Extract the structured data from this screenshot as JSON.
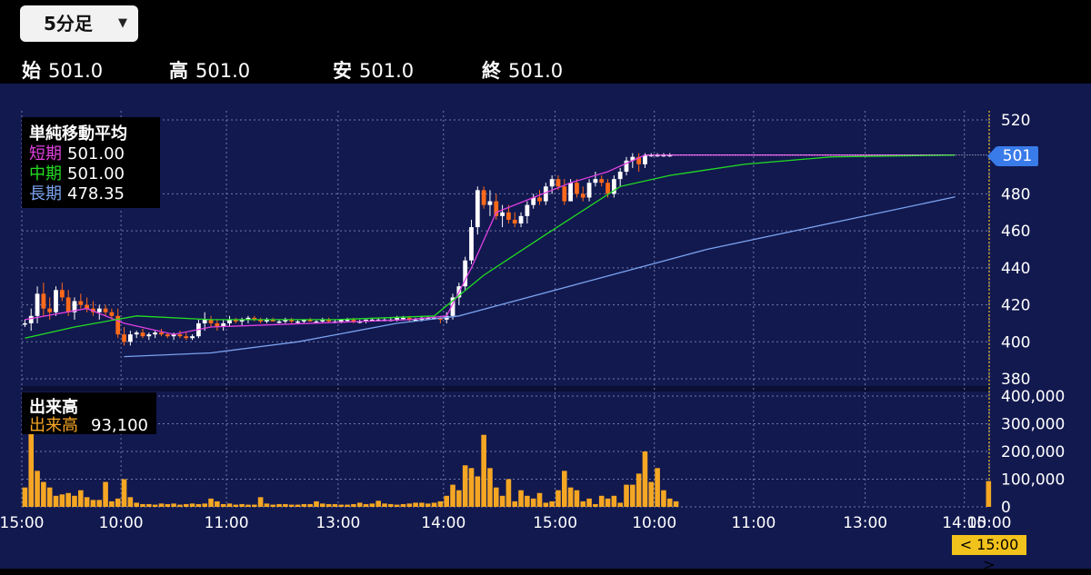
{
  "timeframe": {
    "selected": "5分足",
    "icon": "chevron-down-icon"
  },
  "ohlc": [
    {
      "label": "始",
      "value": "501.0"
    },
    {
      "label": "高",
      "value": "501.0"
    },
    {
      "label": "安",
      "value": "501.0"
    },
    {
      "label": "終",
      "value": "501.0"
    }
  ],
  "legend": {
    "title": "単純移動平均",
    "items": [
      {
        "label": "短期",
        "value": "501.00",
        "color": "#e040e0"
      },
      {
        "label": "中期",
        "value": "501.00",
        "color": "#22dd22"
      },
      {
        "label": "長期",
        "value": "478.35",
        "color": "#7aa2ee"
      }
    ]
  },
  "volume_legend": {
    "title": "出来高",
    "label": "出来高",
    "value": "93,100",
    "color": "#f5a623"
  },
  "current_price": "501",
  "current_time": "< 15:00 >",
  "colors": {
    "background": "#12194f",
    "up": "#ffffff",
    "down": "#ff6a1a",
    "volume": "#f5a623",
    "grid": "#6f7aa8",
    "current": "#3a7bea",
    "time_badge": "#f2c21c"
  },
  "chart_data": [
    {
      "type": "candlestick",
      "y_ticks": [
        520,
        480,
        460,
        440,
        420,
        400,
        380
      ],
      "ylim": [
        380,
        520
      ],
      "x_tick_labels": [
        "15:00",
        "10:00",
        "11:00",
        "13:00",
        "14:00",
        "15:00",
        "10:00",
        "11:00",
        "13:00",
        "14:00",
        "15:00"
      ],
      "candles": [
        [
          410,
          412,
          408,
          410
        ],
        [
          410,
          418,
          406,
          414
        ],
        [
          414,
          430,
          410,
          426
        ],
        [
          426,
          432,
          414,
          418
        ],
        [
          418,
          424,
          412,
          416
        ],
        [
          416,
          430,
          414,
          428
        ],
        [
          428,
          432,
          422,
          424
        ],
        [
          424,
          428,
          414,
          416
        ],
        [
          416,
          424,
          412,
          422
        ],
        [
          422,
          426,
          418,
          420
        ],
        [
          420,
          424,
          416,
          418
        ],
        [
          418,
          422,
          414,
          416
        ],
        [
          416,
          420,
          412,
          418
        ],
        [
          418,
          420,
          414,
          416
        ],
        [
          416,
          418,
          412,
          414
        ],
        [
          414,
          418,
          402,
          404
        ],
        [
          404,
          408,
          398,
          400
        ],
        [
          400,
          406,
          398,
          404
        ],
        [
          404,
          406,
          402,
          405
        ],
        [
          405,
          407,
          402,
          403
        ],
        [
          403,
          405,
          401,
          404
        ],
        [
          404,
          406,
          402,
          405
        ],
        [
          405,
          407,
          403,
          404
        ],
        [
          404,
          405,
          402,
          403
        ],
        [
          403,
          405,
          401,
          404
        ],
        [
          404,
          406,
          402,
          403
        ],
        [
          403,
          405,
          401,
          402
        ],
        [
          402,
          404,
          401,
          403
        ],
        [
          403,
          412,
          402,
          410
        ],
        [
          410,
          416,
          406,
          412
        ],
        [
          412,
          414,
          408,
          410
        ],
        [
          410,
          412,
          406,
          408
        ],
        [
          408,
          412,
          406,
          410
        ],
        [
          410,
          414,
          408,
          412
        ],
        [
          412,
          413,
          410,
          411
        ],
        [
          411,
          413,
          409,
          412
        ],
        [
          412,
          414,
          410,
          413
        ],
        [
          413,
          414,
          411,
          412
        ],
        [
          412,
          413,
          410,
          411
        ],
        [
          411,
          413,
          410,
          412
        ],
        [
          412,
          413,
          411,
          411
        ],
        [
          411,
          412,
          410,
          411
        ],
        [
          411,
          413,
          410,
          412
        ],
        [
          412,
          413,
          410,
          411
        ],
        [
          411,
          412,
          410,
          411
        ],
        [
          411,
          412,
          410,
          412
        ],
        [
          412,
          413,
          411,
          411
        ],
        [
          411,
          412,
          410,
          411
        ],
        [
          411,
          413,
          410,
          412
        ],
        [
          412,
          413,
          410,
          411
        ],
        [
          411,
          412,
          410,
          411
        ],
        [
          411,
          412,
          410,
          412
        ],
        [
          412,
          413,
          411,
          412
        ],
        [
          412,
          413,
          410,
          411
        ],
        [
          411,
          412,
          410,
          411
        ],
        [
          411,
          412,
          410,
          412
        ],
        [
          412,
          413,
          411,
          412
        ],
        [
          412,
          413,
          411,
          412
        ],
        [
          412,
          413,
          411,
          412
        ],
        [
          412,
          413,
          411,
          412
        ],
        [
          412,
          414,
          411,
          413
        ],
        [
          413,
          414,
          412,
          413
        ],
        [
          413,
          414,
          411,
          412
        ],
        [
          412,
          413,
          411,
          412
        ],
        [
          412,
          414,
          411,
          413
        ],
        [
          413,
          414,
          412,
          413
        ],
        [
          413,
          414,
          412,
          413
        ],
        [
          413,
          414,
          410,
          412
        ],
        [
          412,
          416,
          410,
          414
        ],
        [
          414,
          426,
          412,
          424
        ],
        [
          424,
          432,
          420,
          430
        ],
        [
          430,
          446,
          428,
          444
        ],
        [
          444,
          466,
          442,
          462
        ],
        [
          462,
          484,
          458,
          482
        ],
        [
          482,
          484,
          472,
          474
        ],
        [
          474,
          482,
          468,
          476
        ],
        [
          476,
          480,
          466,
          468
        ],
        [
          468,
          474,
          462,
          470
        ],
        [
          470,
          474,
          464,
          466
        ],
        [
          466,
          470,
          462,
          464
        ],
        [
          464,
          470,
          462,
          468
        ],
        [
          468,
          476,
          464,
          474
        ],
        [
          474,
          480,
          472,
          478
        ],
        [
          478,
          482,
          474,
          476
        ],
        [
          476,
          486,
          474,
          484
        ],
        [
          484,
          490,
          480,
          488
        ],
        [
          488,
          490,
          482,
          484
        ],
        [
          484,
          488,
          474,
          476
        ],
        [
          476,
          488,
          476,
          486
        ],
        [
          486,
          488,
          478,
          480
        ],
        [
          480,
          484,
          476,
          478
        ],
        [
          478,
          488,
          476,
          486
        ],
        [
          486,
          492,
          484,
          488
        ],
        [
          488,
          490,
          484,
          486
        ],
        [
          486,
          488,
          478,
          480
        ],
        [
          480,
          490,
          478,
          488
        ],
        [
          488,
          494,
          484,
          492
        ],
        [
          492,
          500,
          490,
          498
        ],
        [
          498,
          502,
          494,
          500
        ],
        [
          500,
          502,
          492,
          496
        ],
        [
          496,
          502,
          494,
          501
        ],
        [
          501,
          502,
          500,
          501
        ],
        [
          501,
          502,
          500,
          501
        ],
        [
          501,
          502,
          500,
          501
        ],
        [
          501,
          502,
          500,
          501
        ]
      ],
      "sma": [
        {
          "name": "短期",
          "x": [
            0,
            10,
            16,
            24,
            30,
            62,
            68,
            72,
            76,
            82,
            88,
            94,
            100,
            150
          ],
          "values": [
            412,
            418,
            410,
            404,
            408,
            412,
            414,
            440,
            470,
            478,
            486,
            492,
            501,
            501
          ]
        },
        {
          "name": "中期",
          "x": [
            0,
            8,
            18,
            30,
            50,
            66,
            74,
            84,
            96,
            104,
            116,
            130,
            150
          ],
          "values": [
            402,
            408,
            414,
            412,
            412,
            414,
            436,
            458,
            484,
            490,
            496,
            500,
            501
          ]
        },
        {
          "name": "長期",
          "x": [
            16,
            30,
            44,
            60,
            70,
            90,
            110,
            150
          ],
          "values": [
            392,
            394,
            400,
            410,
            414,
            432,
            450,
            478.35
          ]
        }
      ]
    },
    {
      "type": "bar",
      "ylabel": "出来高",
      "y_ticks": [
        400000,
        300000,
        200000,
        100000,
        0
      ],
      "ylim": [
        0,
        400000
      ],
      "values": [
        70000,
        300000,
        130000,
        90000,
        70000,
        40000,
        45000,
        50000,
        40000,
        60000,
        35000,
        25000,
        25000,
        90000,
        20000,
        30000,
        100000,
        35000,
        15000,
        10000,
        10000,
        8000,
        12000,
        10000,
        12000,
        8000,
        10000,
        12000,
        10000,
        12000,
        30000,
        20000,
        10000,
        12000,
        8000,
        10000,
        8000,
        8000,
        35000,
        12000,
        8000,
        10000,
        10000,
        8000,
        8000,
        10000,
        10000,
        20000,
        12000,
        10000,
        10000,
        8000,
        8000,
        10000,
        15000,
        10000,
        12000,
        22000,
        12000,
        10000,
        8000,
        10000,
        12000,
        15000,
        15000,
        12000,
        15000,
        20000,
        40000,
        80000,
        60000,
        150000,
        140000,
        110000,
        260000,
        140000,
        70000,
        40000,
        100000,
        20000,
        60000,
        40000,
        30000,
        50000,
        15000,
        20000,
        60000,
        130000,
        70000,
        60000,
        20000,
        30000,
        10000,
        40000,
        30000,
        40000,
        15000,
        80000,
        80000,
        120000,
        200000,
        90000,
        140000,
        60000,
        30000,
        20000,
        0,
        93100
      ]
    }
  ]
}
